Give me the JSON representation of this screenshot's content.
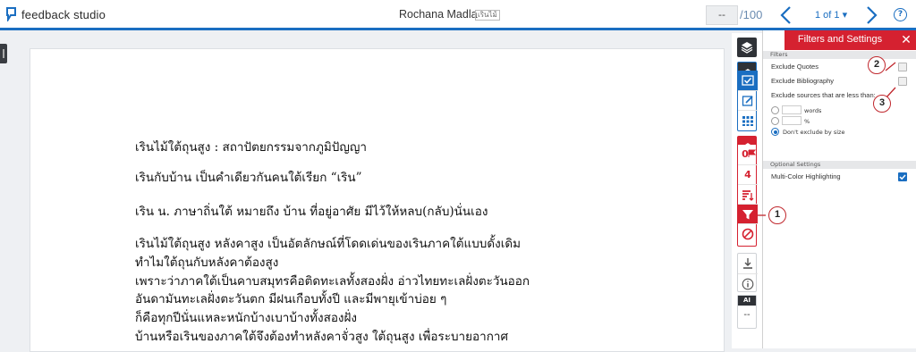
{
  "app": {
    "logo_text": "feedback studio"
  },
  "header": {
    "student_name": "Rochana Madla",
    "doc_tag": "เรินไม้",
    "grade_value": "--",
    "grade_total": "/100",
    "page_indicator": "1 of 1 ▾"
  },
  "document": {
    "lines": [
      "เรินไม้ใต้ถุนสูง : สถาปัตยกรรมจากภูมิปัญญา",
      "เรินกับบ้าน เป็นคำเดียวกันคนใต้เรียก “เริน”",
      "เริน น. ภาษาถิ่นใต้ หมายถึง บ้าน ที่อยู่อาศัย มีไว้ให้หลบ(กลับ)นั่นเอง",
      "เรินไม้ใต้ถุนสูง หลังคาสูง เป็นอัตลักษณ์ที่โดดเด่นของเรินภาคใต้แบบดั้งเดิม",
      "ทำไมใต้ถุนกับหลังคาต้องสูง",
      "เพราะว่าภาคใต้เป็นคาบสมุทรคือติดทะเลทั้งสองฝั่ง อ่าวไทยทะเลฝั่งตะวันออก",
      "อันดามันทะเลฝั่งตะวันตก มีฝนเกือบทั้งปี และมีพายุเข้าบ่อย ๆ",
      "ก็คือทุกปีนั่นแหละหนักบ้างเบาบ้างทั้งสองฝั่ง",
      "บ้านหรือเรินของภาคใต้จึงต้องทำหลังคาจั่วสูง ใต้ถุนสูง เพื่อระบายอากาศ"
    ]
  },
  "sidebar": {
    "match_count": "0",
    "flag_count": "4",
    "ai_label": "AI",
    "ai_value": "--"
  },
  "panel": {
    "title": "Filters and Settings",
    "close_symbol": "✕",
    "filters_header": "Filters",
    "exclude_quotes": "Exclude Quotes",
    "exclude_bibliography": "Exclude Bibliography",
    "exclude_sources": "Exclude sources that are less than:",
    "words_unit": "words",
    "percent_unit": "%",
    "dont_exclude": "Don't exclude by size",
    "optional_header": "Optional Settings",
    "multi_color": "Multi-Color Highlighting"
  },
  "annotations": {
    "one": "1",
    "two": "2",
    "three": "3"
  },
  "colors": {
    "brand_blue": "#1a6ec1",
    "filter_red": "#d52130"
  },
  "icons": [
    "layers-icon",
    "check-icon",
    "edit-icon",
    "grid-icon",
    "flag-icon",
    "sort-icon",
    "filter-icon",
    "exclude-icon",
    "download-icon",
    "info-icon"
  ]
}
